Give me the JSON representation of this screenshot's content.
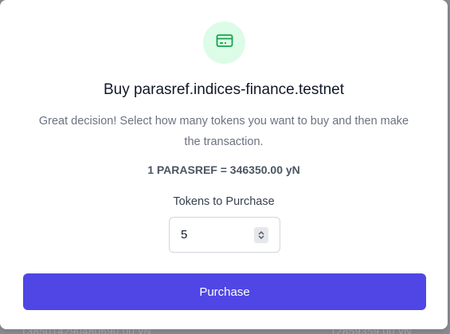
{
  "modal": {
    "icon": "credit-card-icon",
    "title": "Buy parasref.indices-finance.testnet",
    "description": "Great decision! Select how many tokens you want to buy and then make the transaction.",
    "rate": "1 PARASREF = 346350.00 yN",
    "quantity_label": "Tokens to Purchase",
    "quantity_value": "5",
    "purchase_label": "Purchase"
  },
  "colors": {
    "accent": "#4f46e5",
    "icon_bg": "#dcfce7",
    "icon_fg": "#16a34a"
  }
}
